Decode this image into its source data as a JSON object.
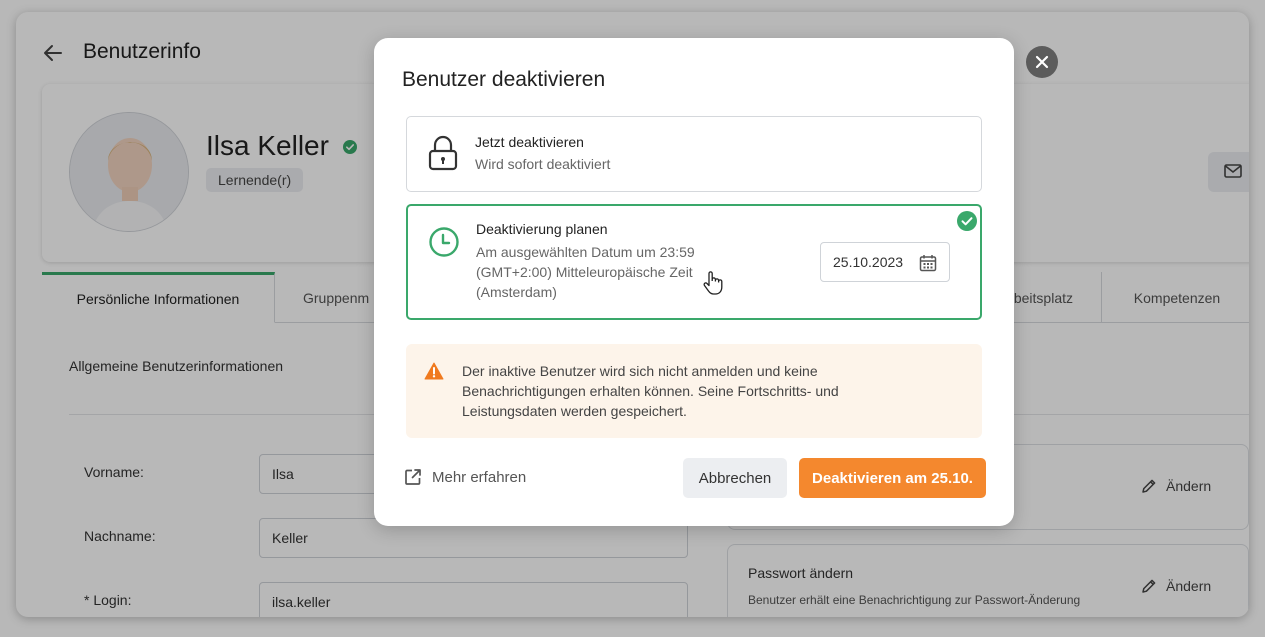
{
  "page": {
    "title": "Benutzerinfo"
  },
  "profile": {
    "name": "Ilsa Keller",
    "role": "Lernende(r)"
  },
  "tabs": [
    {
      "label": "Persönliche Informationen",
      "active": true
    },
    {
      "label": "Gruppenm",
      "active": false
    },
    {
      "label": "beitsplatz",
      "active": false
    },
    {
      "label": "Kompetenzen",
      "active": false
    }
  ],
  "section": {
    "title": "Allgemeine Benutzerinformationen"
  },
  "form": {
    "first_name_label": "Vorname:",
    "first_name_value": "Ilsa",
    "last_name_label": "Nachname:",
    "last_name_value": "Keller",
    "login_label": "*  Login:",
    "login_value": "ilsa.keller"
  },
  "side_cards": {
    "card1_edit": "Ändern",
    "password_title": "Passwort ändern",
    "password_desc": "Benutzer erhält eine Benachrichtigung zur Passwort-Änderung",
    "password_edit": "Ändern"
  },
  "modal": {
    "title": "Benutzer deaktivieren",
    "option_now": {
      "title": "Jetzt deaktivieren",
      "desc": "Wird sofort deaktiviert",
      "icon": "lock-icon",
      "selected": false
    },
    "option_schedule": {
      "title": "Deaktivierung planen",
      "desc_line1": "Am ausgewählten Datum um 23:59",
      "desc_line2": "(GMT+2:00) Mitteleuropäische Zeit",
      "desc_line3": "(Amsterdam)",
      "date_value": "25.10.2023",
      "icon": "clock-icon",
      "selected": true
    },
    "warning": {
      "line1": "Der inaktive Benutzer wird sich nicht anmelden und keine",
      "line2": "Benachrichtigungen erhalten können. Seine Fortschritts- und",
      "line3": "Leistungsdaten werden gespeichert."
    },
    "learn_more": "Mehr erfahren",
    "cancel": "Abbrechen",
    "confirm": "Deaktivieren am 25.10."
  },
  "colors": {
    "accent_green": "#3aa86b",
    "confirm_orange": "#f4882e",
    "warning_bg": "#fdf4ea",
    "warning_icon": "#f07a1f"
  }
}
